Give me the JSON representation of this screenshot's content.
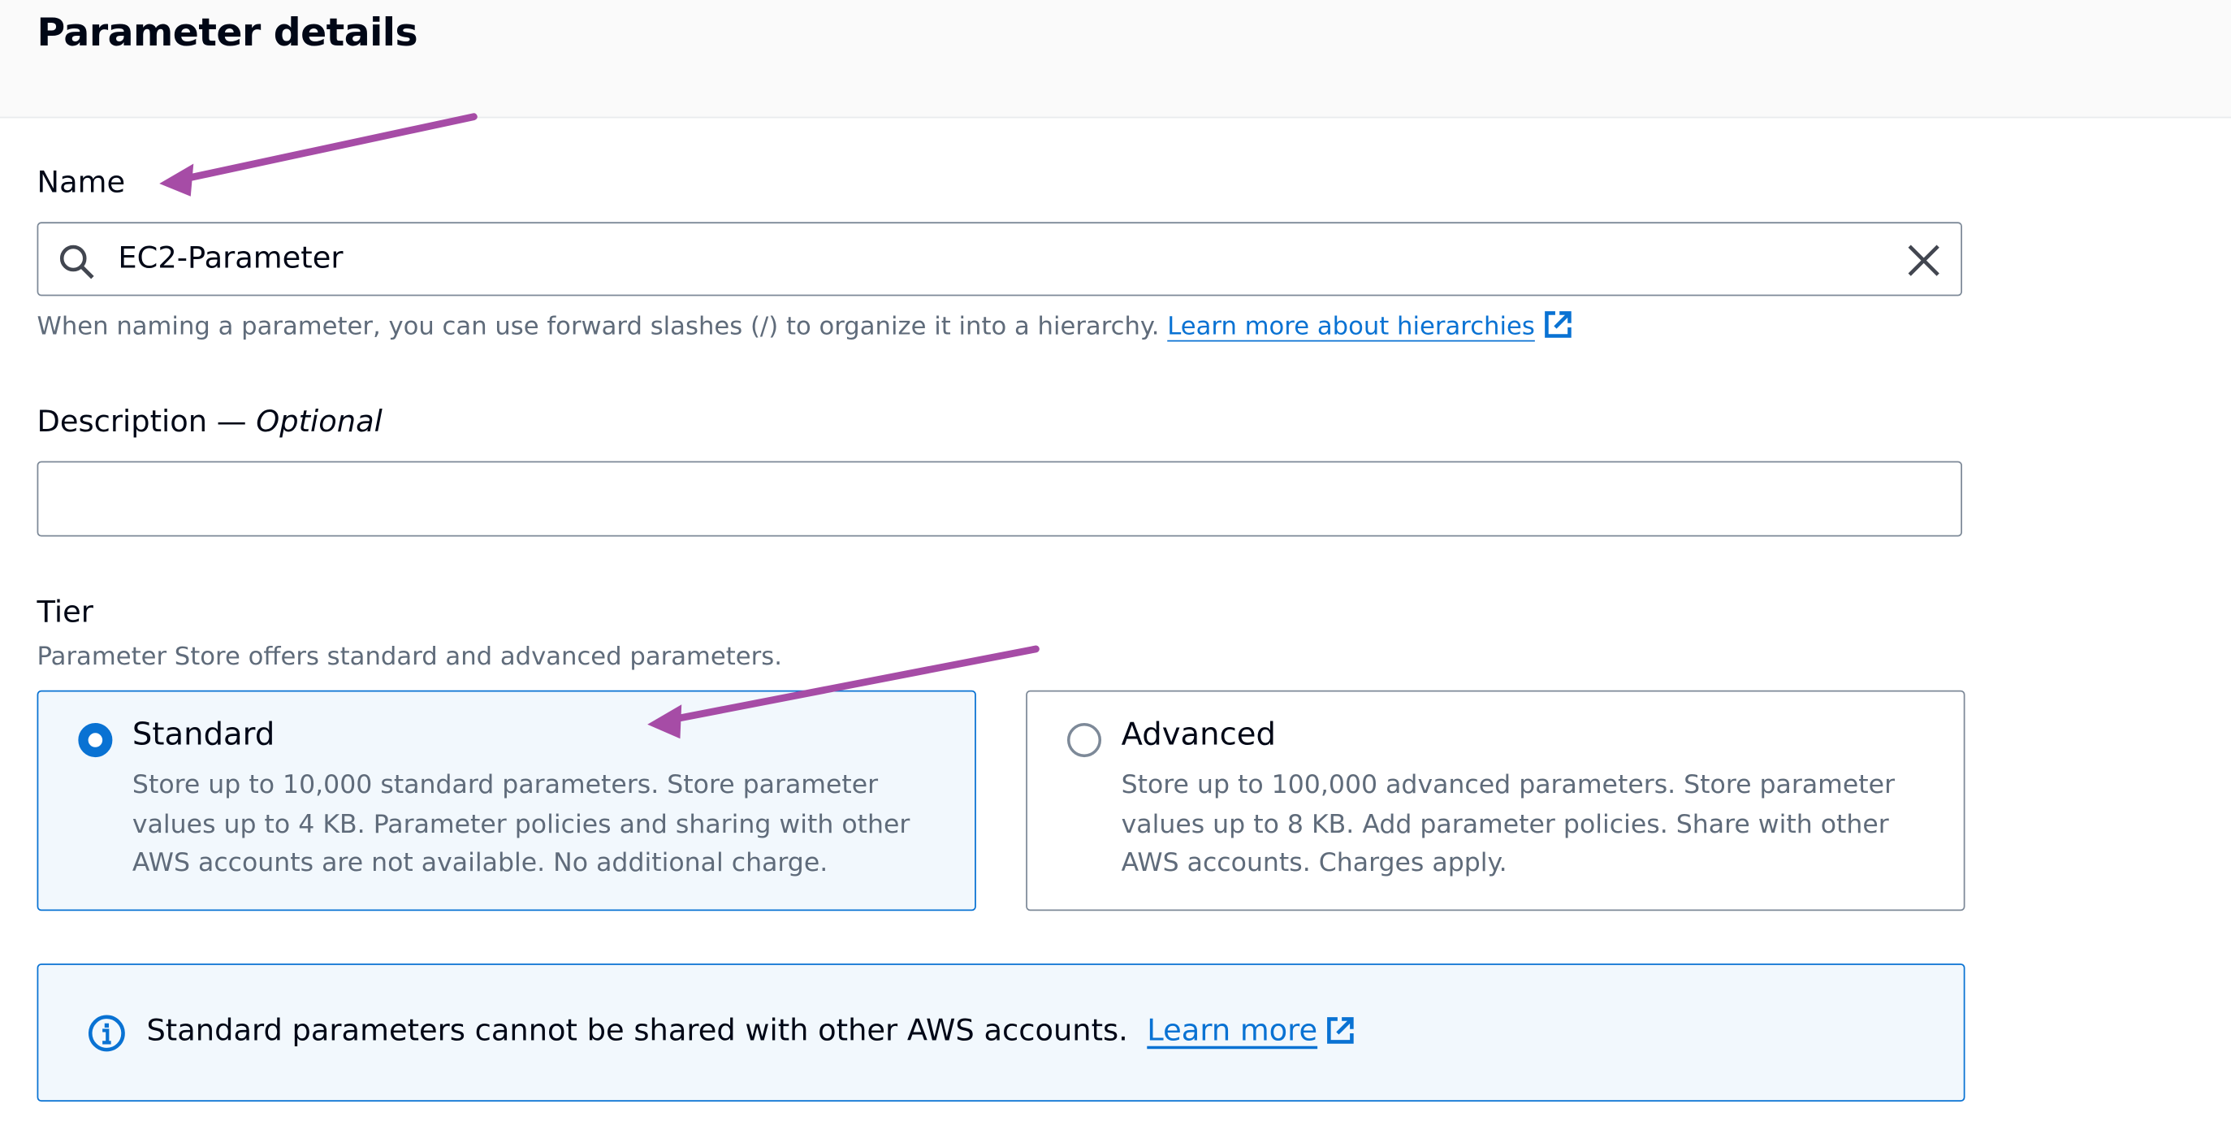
{
  "header": {
    "title": "Parameter details"
  },
  "name_field": {
    "label": "Name",
    "value": "EC2-Parameter",
    "hint": "When naming a parameter, you can use forward slashes (/) to organize it into a hierarchy.",
    "link": "Learn more about hierarchies"
  },
  "description_field": {
    "label": "Description",
    "optional": "Optional",
    "separator": " — ",
    "value": ""
  },
  "tier": {
    "label": "Tier",
    "hint": "Parameter Store offers standard and advanced parameters.",
    "options": [
      {
        "title": "Standard",
        "selected": true,
        "description": "Store up to 10,000 standard parameters. Store parameter values up to 4 KB. Parameter policies and sharing with other AWS accounts are not available. No additional charge."
      },
      {
        "title": "Advanced",
        "selected": false,
        "description": "Store up to 100,000 advanced parameters. Store parameter values up to 8 KB. Add parameter policies. Share with other AWS accounts. Charges apply."
      }
    ]
  },
  "info_alert": {
    "text": "Standard parameters cannot be shared with other AWS accounts.",
    "link": "Learn more"
  },
  "colors": {
    "accent": "#0972d3",
    "annotation_arrow": "#a64ca6",
    "selected_bg": "#f2f8fd"
  }
}
